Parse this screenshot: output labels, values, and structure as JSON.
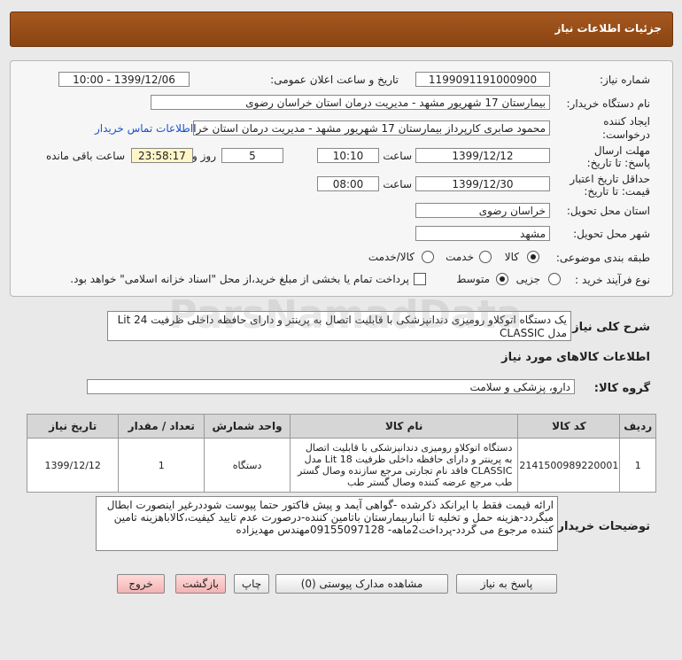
{
  "header": {
    "title": "جزئیات اطلاعات نیاز"
  },
  "form": {
    "need_number_label": "شماره نیاز:",
    "need_number": "1199091191000900",
    "announce_label": "تاریخ و ساعت اعلان عمومی:",
    "announce_value": "1399/12/06 - 10:00",
    "buyer_label": "نام دستگاه خریدار:",
    "buyer_value": "بیمارستان 17 شهریور مشهد - مدیریت درمان استان خراسان رضوی",
    "creator_label": "ایجاد کننده درخواست:",
    "creator_value": "محمود صابری کارپرداز بیمارستان 17 شهریور مشهد - مدیریت درمان استان خراس",
    "contact_link": "اطلاعات تماس خریدار",
    "deadline_label": "مهلت ارسال پاسخ: تا تاریخ:",
    "deadline_date": "1399/12/12",
    "time_label": "ساعت",
    "deadline_time": "10:10",
    "days_value": "5",
    "days_label": "روز و",
    "remaining_time": "23:58:17",
    "remaining_label": "ساعت باقی مانده",
    "validity_label": "حداقل تاریخ اعتبار قیمت: تا تاریخ:",
    "validity_date": "1399/12/30",
    "validity_time": "08:00",
    "province_label": "استان محل تحویل:",
    "province_value": "خراسان رضوی",
    "city_label": "شهر محل تحویل:",
    "city_value": "مشهد",
    "category_label": "طبقه بندی موضوعی:",
    "category_options": [
      "کالا",
      "خدمت",
      "کالا/خدمت"
    ],
    "process_label": "نوع فرآیند خرید :",
    "process_options": [
      "جزیی",
      "متوسط"
    ],
    "payment_note": "پرداخت تمام یا بخشی از مبلغ خرید،از محل \"اسناد خزانه اسلامی\" خواهد بود."
  },
  "description": {
    "label": "شرح کلی نیاز:",
    "text": "یک دستگاه اتوکلاو رومیزی دندانپزشکی با قابلیت اتصال به پرینتر و دارای حافظه داخلی ظرفیت Lit 24 مدل CLASSIC"
  },
  "goods_section_title": "اطلاعات کالاهای مورد نیاز",
  "goods_group": {
    "label": "گروه کالا:",
    "value": "دارو، پزشکی و سلامت"
  },
  "table": {
    "headers": [
      "ردیف",
      "کد کالا",
      "نام کالا",
      "واحد شمارش",
      "تعداد / مقدار",
      "تاریخ نیاز"
    ],
    "rows": [
      {
        "row": "1",
        "code": "2141500989220001",
        "name": "دستگاه اتوکلاو رومیزی دندانپزشکی با قابلیت اتصال به پرینتر و دارای حافظه داخلی ظرفیت Lit 18 مدل CLASSIC فاقد نام تجارتی مرجع سازنده وصال گستر طب مرجع عرضه کننده وصال گستر طب",
        "unit": "دستگاه",
        "qty": "1",
        "date": "1399/12/12"
      }
    ]
  },
  "buyer_notes": {
    "label": "توضیحات خریدار:",
    "text": "ارائه قیمت فقط با ایرانکد ذکرشده -گواهی آیمد و پیش فاکتور حتما پیوست شوددرغیر اینصورت ابطال میگردد-هزینه حمل و تخلیه تا انباربیمارستان باتامین کننده-درصورت عدم تایید کیفیت،کالاباهزینه تامین کننده مرجوع می گردد-پرداخت2ماهه- 09155097128مهندس مهدیزاده"
  },
  "buttons": {
    "reply": "پاسخ به نیاز",
    "attachments": "مشاهده مدارک پیوستی (0)",
    "print": "چاپ",
    "back": "بازگشت",
    "exit": "خروج"
  },
  "watermark": "ParsNamadData"
}
